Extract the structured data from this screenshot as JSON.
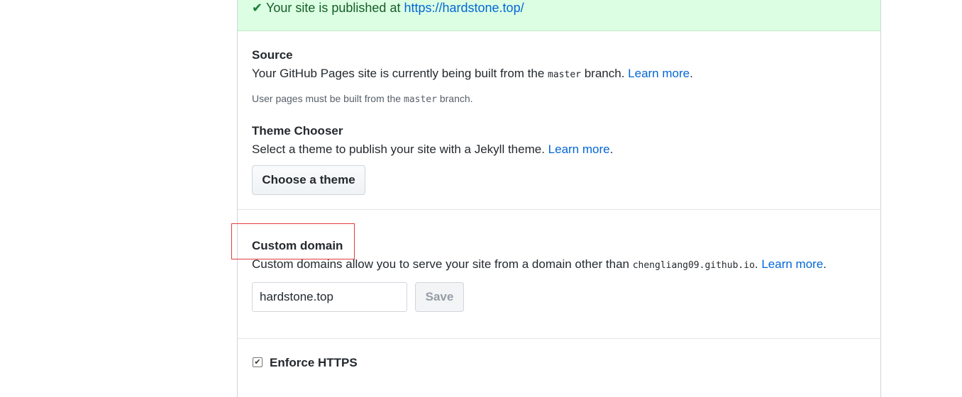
{
  "flash": {
    "icon": "check-icon",
    "message": "Your site is published at ",
    "url": "https://hardstone.top/"
  },
  "source": {
    "title": "Source",
    "text_before": "Your GitHub Pages site is currently being built from the ",
    "branch": "master",
    "text_after": " branch. ",
    "learn_more": "Learn more",
    "period": ".",
    "note_before": "User pages must be built from the ",
    "note_branch": "master",
    "note_after": " branch."
  },
  "theme": {
    "title": "Theme Chooser",
    "text": "Select a theme to publish your site with a Jekyll theme. ",
    "learn_more": "Learn more",
    "period": ".",
    "button_label": "Choose a theme"
  },
  "custom_domain": {
    "title": "Custom domain",
    "text_before": "Custom domains allow you to serve your site from a domain other than ",
    "default_domain": "chengliang09.github.io",
    "text_after": ". ",
    "learn_more": "Learn more",
    "period": ".",
    "input_value": "hardstone.top",
    "save_label": "Save"
  },
  "https": {
    "title": "Enforce HTTPS",
    "checked": true
  },
  "colors": {
    "flash_bg": "#dcffe4",
    "link": "#0366d6",
    "highlight": "#e33c3c"
  }
}
